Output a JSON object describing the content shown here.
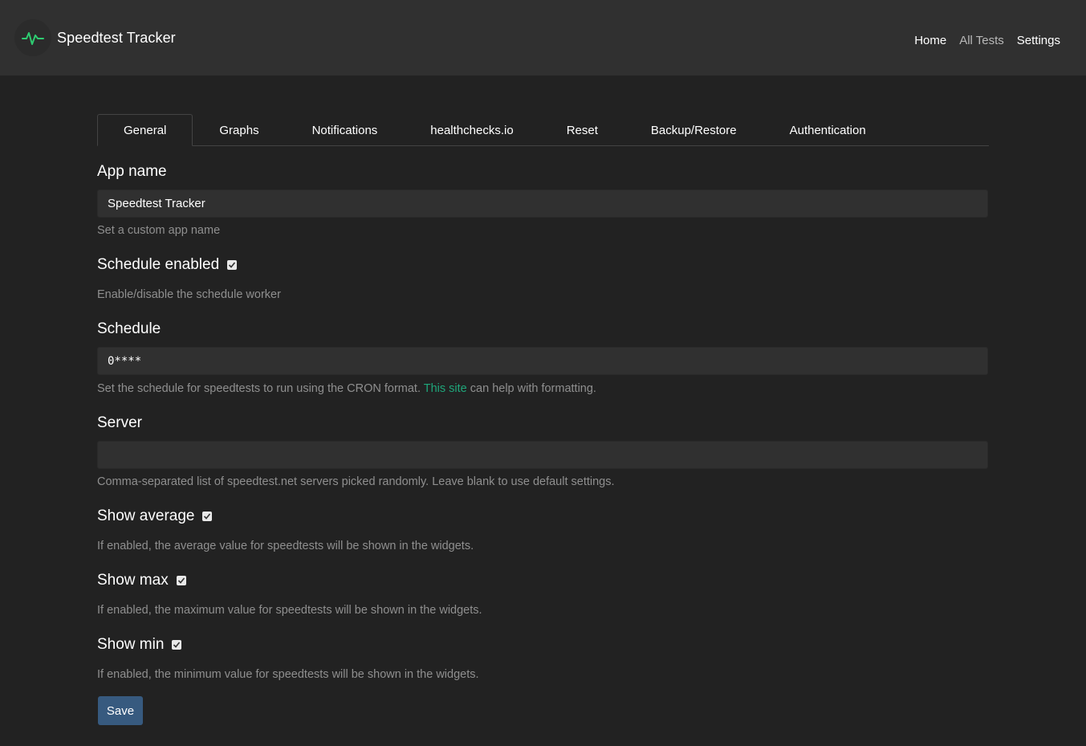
{
  "header": {
    "brand_title": "Speedtest Tracker",
    "logo_icon": "pulse-icon",
    "accent": "#2ecc71",
    "nav": {
      "home": "Home",
      "all_tests": "All Tests",
      "settings": "Settings"
    }
  },
  "tabs": [
    "General",
    "Graphs",
    "Notifications",
    "healthchecks.io",
    "Reset",
    "Backup/Restore",
    "Authentication"
  ],
  "fields": {
    "app_name": {
      "label": "App name",
      "value": "Speedtest Tracker",
      "help": "Set a custom app name"
    },
    "schedule_enabled": {
      "label": "Schedule enabled",
      "checked": true,
      "help": "Enable/disable the schedule worker"
    },
    "schedule": {
      "label": "Schedule",
      "value": "0****",
      "help_before": "Set the schedule for speedtests to run using the CRON format.",
      "link_text": "This site",
      "help_after": "can help with formatting."
    },
    "server": {
      "label": "Server",
      "value": "",
      "help": "Comma-separated list of speedtest.net servers picked randomly. Leave blank to use default settings."
    },
    "show_average": {
      "label": "Show average",
      "checked": true,
      "help": "If enabled, the average value for speedtests will be shown in the widgets."
    },
    "show_max": {
      "label": "Show max",
      "checked": true,
      "help": "If enabled, the maximum value for speedtests will be shown in the widgets."
    },
    "show_min": {
      "label": "Show min",
      "checked": true,
      "help": "If enabled, the minimum value for speedtests will be shown in the widgets."
    }
  },
  "save_label": "Save",
  "colors": {
    "background": "#222222",
    "navbar": "#303030",
    "input": "#303030",
    "primary": "#375a7f",
    "link": "#1fa67a"
  }
}
